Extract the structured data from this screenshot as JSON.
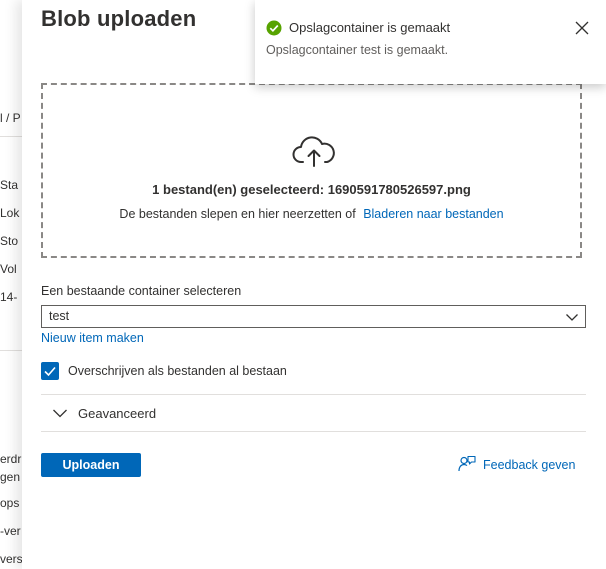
{
  "background_page": {
    "fragments": [
      "l / P",
      "Sta",
      "Lok",
      "Sto",
      "Vol",
      "14-",
      "erdr",
      "gen",
      "ops",
      "-ver",
      "vers"
    ]
  },
  "panel": {
    "title": "Blob uploaden",
    "dropzone": {
      "icon": "cloud-upload-icon",
      "selected_file": "1 bestand(en) geselecteerd: 1690591780526597.png",
      "hint_text": "De bestanden slepen en hier neerzetten  of",
      "browse_link": "Bladeren naar bestanden"
    },
    "container": {
      "label": "Een bestaande container selecteren",
      "selected_value": "test",
      "new_item_link": "Nieuw item maken"
    },
    "overwrite": {
      "checked": true,
      "label": "Overschrijven als bestanden al bestaan"
    },
    "advanced": {
      "label": "Geavanceerd"
    },
    "upload_button": "Uploaden",
    "feedback_link": "Feedback geven"
  },
  "toast": {
    "title": "Opslagcontainer is gemaakt",
    "message": "Opslagcontainer test is gemaakt.",
    "status_color": "#57a300"
  },
  "colors": {
    "accent": "#0067b8",
    "text": "#323130",
    "success": "#57a300"
  }
}
